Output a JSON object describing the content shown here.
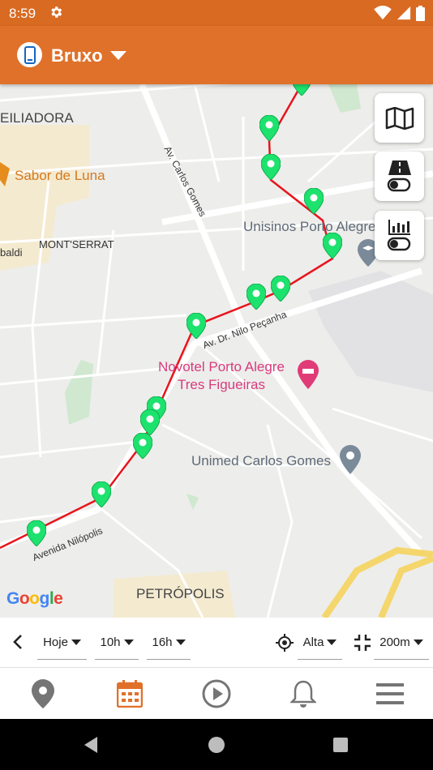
{
  "status_bar": {
    "time": "8:59",
    "icons": [
      "gear-icon",
      "wifi-icon",
      "signal-icon",
      "battery-icon"
    ]
  },
  "app_bar": {
    "device_name": "Bruxo",
    "device_icon": "phone-icon",
    "accent": "#e0712a"
  },
  "map": {
    "labels": {
      "neighborhood_top": "EILIADORA",
      "restaurant": "Sabor de Luna",
      "avenue_carlos_gomes": "Av. Carlos Gomes",
      "university": "Unisinos Porto Alegre",
      "montserrat": "MONT'SERRAT",
      "street_left": "baldi",
      "avenue_nilo": "Av. Dr. Nilo Peçanha",
      "hotel_line1": "Novotel Porto Alegre",
      "hotel_line2": "Tres Figueiras",
      "unimed": "Unimed Carlos Gomes",
      "avenue_nilopolis": "Avenida Nilópolis",
      "petropolis": "PETRÓPOLIS",
      "google": "Google"
    },
    "route_color": "#e8141c",
    "marker_color": "#1de26e",
    "controls": [
      "map-type-icon",
      "road-toggle-icon",
      "chart-toggle-icon"
    ]
  },
  "filters": {
    "day": "Hoje",
    "from_hour": "10h",
    "to_hour": "16h",
    "precision": "Alta",
    "distance": "200m"
  },
  "bottom_nav": [
    "location-icon",
    "calendar-icon",
    "play-icon",
    "bell-icon",
    "menu-icon"
  ],
  "active_nav": "calendar-icon"
}
